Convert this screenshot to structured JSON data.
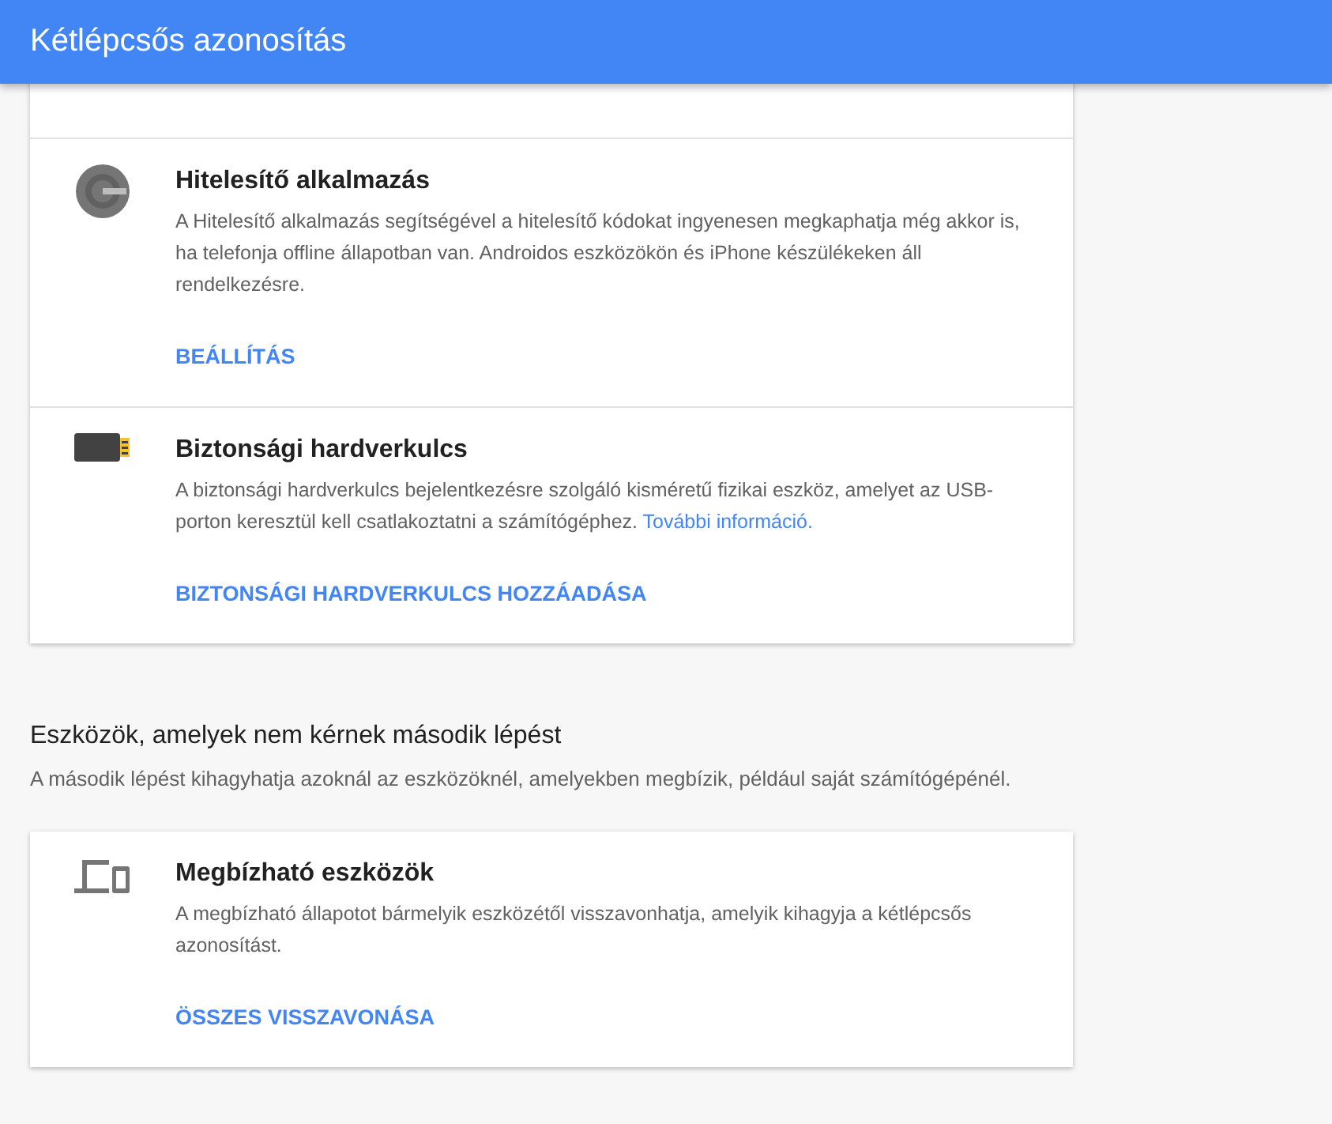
{
  "header": {
    "title": "Kétlépcsős azonosítás"
  },
  "methods": [
    {
      "kind": "authenticator",
      "title": "Hitelesítő alkalmazás",
      "description": "A Hitelesítő alkalmazás segítségével a hitelesítő kódokat ingyenesen megkaphatja még akkor is, ha telefonja offline állapotban van. Androidos eszközökön és iPhone készülékeken áll rendelkezésre.",
      "action": "BEÁLLÍTÁS"
    },
    {
      "kind": "security-key",
      "title": "Biztonsági hardverkulcs",
      "description": "A biztonsági hardverkulcs bejelentkezésre szolgáló kisméretű fizikai eszköz, amelyet az USB-porton keresztül kell csatlakoztatni a számítógéphez.",
      "link": "További információ.",
      "action": "BIZTONSÁGI HARDVERKULCS HOZZÁADÁSA"
    }
  ],
  "devices_section": {
    "heading": "Eszközök, amelyek nem kérnek második lépést",
    "description": "A második lépést kihagyhatja azoknál az eszközöknél, amelyekben megbízik, például saját számítógépénél.",
    "items": [
      {
        "kind": "devices",
        "title": "Megbízható eszközök",
        "description": "A megbízható állapotot bármelyik eszközétől visszavonhatja, amelyik kihagyja a kétlépcsős azonosítást.",
        "action": "ÖSSZES VISSZAVONÁSA"
      }
    ]
  }
}
